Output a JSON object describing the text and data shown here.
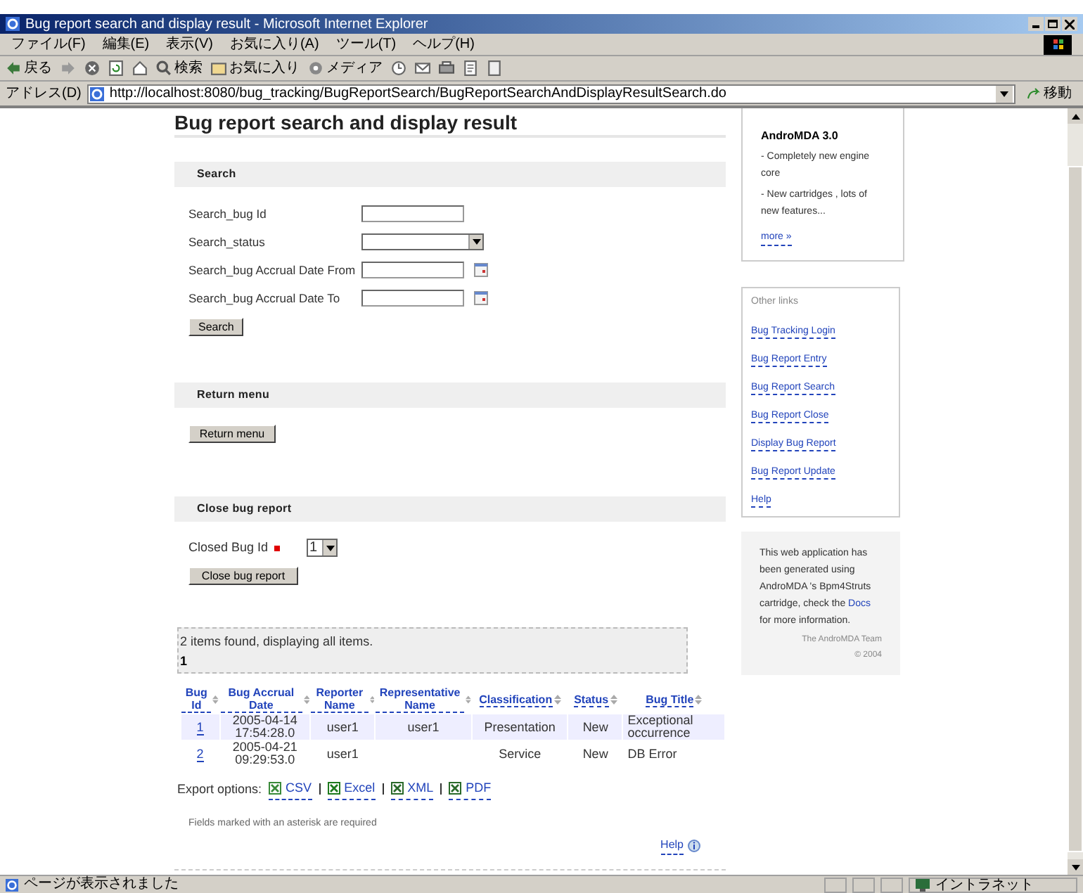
{
  "window": {
    "title": "Bug report search and display result - Microsoft Internet Explorer"
  },
  "menu": [
    "ファイル(F)",
    "編集(E)",
    "表示(V)",
    "お気に入り(A)",
    "ツール(T)",
    "ヘルプ(H)"
  ],
  "toolbar": [
    {
      "kind": "back",
      "label": "戻る"
    },
    {
      "kind": "forward"
    },
    {
      "kind": "stop"
    },
    {
      "kind": "refresh"
    },
    {
      "kind": "home"
    },
    {
      "kind": "search",
      "label": "検索"
    },
    {
      "kind": "favorites",
      "label": "お気に入り"
    },
    {
      "kind": "media",
      "label": "メディア"
    },
    {
      "kind": "history"
    },
    {
      "kind": "mail"
    },
    {
      "kind": "print"
    },
    {
      "kind": "edit"
    },
    {
      "kind": "discuss"
    }
  ],
  "address": {
    "label": "アドレス(D)",
    "url": "http://localhost:8080/bug_tracking/BugReportSearch/BugReportSearchAndDisplayResultSearch.do",
    "go": "移動"
  },
  "page": {
    "heading": "Bug report search and display result",
    "search": {
      "title": "Search",
      "fields": [
        {
          "kind": "text",
          "label": "Search_bug Id"
        },
        {
          "kind": "select",
          "label": "Search_status"
        },
        {
          "kind": "date",
          "label": "Search_bug Accrual Date From"
        },
        {
          "kind": "date",
          "label": "Search_bug Accrual Date To"
        }
      ],
      "button": "Search"
    },
    "return_menu": {
      "title": "Return menu",
      "button": "Return menu"
    },
    "close_bug": {
      "title": "Close bug report",
      "field_label": "Closed Bug Id",
      "required": true,
      "value": "1",
      "button": "Close bug report"
    },
    "result": {
      "summary": "2 items found, displaying all items.",
      "pages": "1"
    },
    "table": {
      "columns": [
        "Bug Id",
        "Bug Accrual Date",
        "Reporter Name",
        "Representative Name",
        "Classification",
        "Status",
        "Bug Title"
      ],
      "rows": [
        [
          "1",
          "2005-04-14 17:54:28.0",
          "user1",
          "user1",
          "Presentation",
          "New",
          "Exceptional occurrence"
        ],
        [
          "2",
          "2005-04-21 09:29:53.0",
          "user1",
          "",
          "Service",
          "New",
          "DB Error"
        ]
      ]
    },
    "export": {
      "label": "Export options:",
      "options": [
        {
          "kind": "csv",
          "label": "CSV"
        },
        {
          "kind": "excel",
          "label": "Excel"
        },
        {
          "kind": "xml",
          "label": "XML"
        },
        {
          "kind": "pdf",
          "label": "PDF"
        }
      ]
    },
    "note": "Fields marked with an asterisk are required",
    "help": "Help"
  },
  "sidebar": {
    "news": {
      "title": "AndroMDA 3.0",
      "lines": [
        "- Completely new engine core",
        "- New cartridges , lots of new features..."
      ],
      "more": "more »"
    },
    "links": {
      "title": "Other links",
      "items": [
        "Bug Tracking Login",
        "Bug Report Entry",
        "Bug Report Search",
        "Bug Report Close",
        "Display Bug Report",
        "Bug Report Update",
        "Help"
      ]
    },
    "info": {
      "text_before": "This web application has been generated using AndroMDA 's Bpm4Struts cartridge, check the",
      "link": "Docs",
      "text_after": "for more information.",
      "team": "The AndroMDA Team",
      "year": "© 2004"
    }
  },
  "status_bar": {
    "text": "ページが表示されました",
    "zone": "イントラネット"
  }
}
